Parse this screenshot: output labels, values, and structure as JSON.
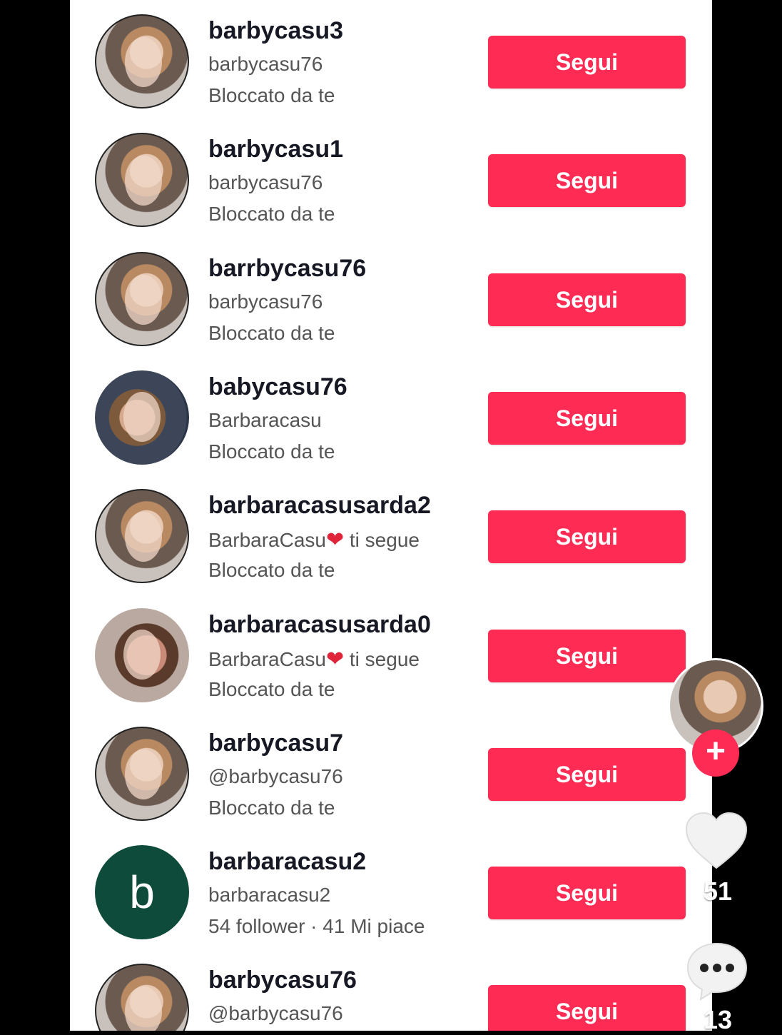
{
  "results": [
    {
      "username": "barbycasu3",
      "nickname": "barbycasu76",
      "nick_suffix": "",
      "heart": false,
      "status": "Bloccato da te",
      "button": "Segui",
      "avatar": "photo-a"
    },
    {
      "username": "barbycasu1",
      "nickname": "barbycasu76",
      "nick_suffix": "",
      "heart": false,
      "status": "Bloccato da te",
      "button": "Segui",
      "avatar": "photo-a"
    },
    {
      "username": "barrbycasu76",
      "nickname": "barbycasu76",
      "nick_suffix": "",
      "heart": false,
      "status": "Bloccato da te",
      "button": "Segui",
      "avatar": "photo-a"
    },
    {
      "username": "babycasu76",
      "nickname": "Barbaracasu",
      "nick_suffix": "",
      "heart": false,
      "status": "Bloccato da te",
      "button": "Segui",
      "avatar": "photo-b"
    },
    {
      "username": "barbaracasusarda2",
      "nickname": "BarbaraCasu",
      "nick_suffix": " ti segue",
      "heart": true,
      "status": "Bloccato da te",
      "button": "Segui",
      "avatar": "photo-a"
    },
    {
      "username": "barbaracasusarda0",
      "nickname": "BarbaraCasu",
      "nick_suffix": " ti segue",
      "heart": true,
      "status": "Bloccato da te",
      "button": "Segui",
      "avatar": "photo-c"
    },
    {
      "username": "barbycasu7",
      "nickname": "@barbycasu76",
      "nick_suffix": "",
      "heart": false,
      "status": "Bloccato da te",
      "button": "Segui",
      "avatar": "photo-a"
    },
    {
      "username": "barbaracasu2",
      "nickname": "barbaracasu2",
      "nick_suffix": "",
      "heart": false,
      "status": "54 follower · 41 Mi piace",
      "button": "Segui",
      "avatar": "letter",
      "avatar_letter": "b"
    },
    {
      "username": "barbycasu76",
      "nickname": "@barbycasu76",
      "nick_suffix": "",
      "heart": false,
      "status": "",
      "button": "Segui",
      "avatar": "photo-a"
    }
  ],
  "side_actions": {
    "follow_plus": "+",
    "likes_count": "51",
    "comments_count": "13"
  },
  "colors": {
    "accent": "#fe2c55",
    "letter_avatar_bg": "#0f4b3a"
  }
}
